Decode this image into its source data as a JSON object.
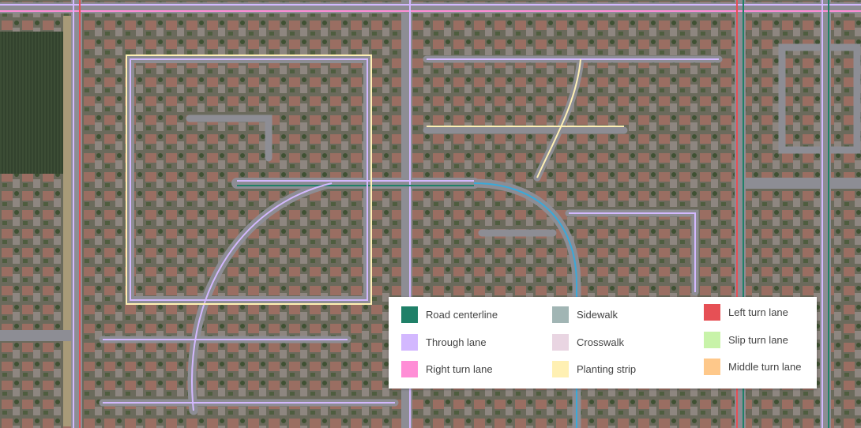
{
  "legend": {
    "items": [
      {
        "label": "Road centerline",
        "color": "#1f8068"
      },
      {
        "label": "Through lane",
        "color": "#d3b8ff"
      },
      {
        "label": "Right turn lane",
        "color": "#ff8ed6"
      },
      {
        "label": "Sidewalk",
        "color": "#a1b5b4"
      },
      {
        "label": "Crosswalk",
        "color": "#e9d5e2"
      },
      {
        "label": "Planting strip",
        "color": "#fff0b3"
      },
      {
        "label": "Left turn lane",
        "color": "#e65055"
      },
      {
        "label": "Slip turn lane",
        "color": "#c8f3a9"
      },
      {
        "label": "Middle turn lane",
        "color": "#fec88a"
      }
    ]
  }
}
